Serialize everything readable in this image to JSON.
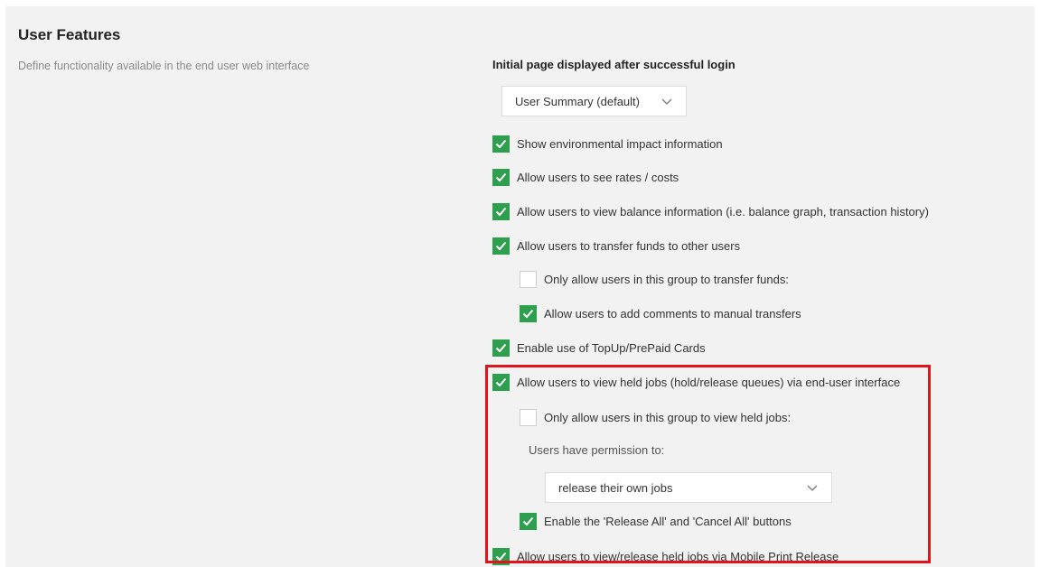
{
  "section": {
    "title": "User Features",
    "description": "Define functionality available in the end user web interface"
  },
  "initial_page": {
    "label": "Initial page displayed after successful login",
    "selected": "User Summary (default)"
  },
  "options": {
    "env_impact": {
      "label": "Show environmental impact information",
      "checked": true
    },
    "rates": {
      "label": "Allow users to see rates / costs",
      "checked": true
    },
    "balance": {
      "label": "Allow users to view balance information (i.e. balance graph, transaction history)",
      "checked": true
    },
    "transfer": {
      "label": "Allow users to transfer funds to other users",
      "checked": true
    },
    "transfer_group_only": {
      "label": "Only allow users in this group to transfer funds:",
      "checked": false
    },
    "transfer_comments": {
      "label": "Allow users to add comments to manual transfers",
      "checked": true
    },
    "topup": {
      "label": "Enable use of TopUp/PrePaid Cards",
      "checked": true
    },
    "held_jobs": {
      "label": "Allow users to view held jobs (hold/release queues) via end-user interface",
      "checked": true
    },
    "held_group_only": {
      "label": "Only allow users in this group to view held jobs:",
      "checked": false
    },
    "release_all": {
      "label": "Enable the 'Release All' and 'Cancel All' buttons",
      "checked": true
    },
    "mobile_release": {
      "label": "Allow users to view/release held jobs via Mobile Print Release",
      "checked": true
    }
  },
  "permission": {
    "label": "Users have permission to:",
    "selected": "release their own jobs"
  },
  "colors": {
    "checkbox_on": "#2e9e4f",
    "highlight": "#e0141c",
    "panel_bg": "#f2f2f2"
  }
}
